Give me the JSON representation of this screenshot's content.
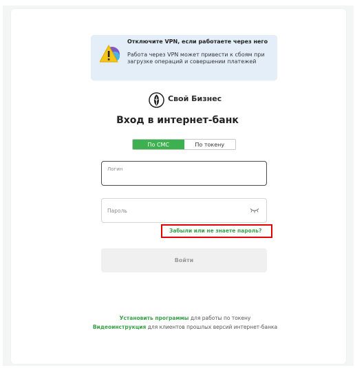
{
  "vpn_notice": {
    "title": "Отключите VPN, если работаете через него",
    "body": "Работа через VPN может привести к сбоям при загрузке операций и совершении платежей",
    "icon": "warning-icon"
  },
  "brand": {
    "name": "Свой Бизнес",
    "icon": "brand-logo"
  },
  "page_title": "Вход в интернет-банк",
  "tabs": [
    {
      "label": "По СМС",
      "active": true
    },
    {
      "label": "По токену",
      "active": false
    }
  ],
  "login_field": {
    "label": "Логин"
  },
  "password_field": {
    "label": "Пароль",
    "icon": "eye-closed-icon"
  },
  "forgot_link": "Забыли или не знаете пароль?",
  "login_button": "Войти",
  "footer": {
    "line1_link": "Установить программы",
    "line1_text": " для работы по токену",
    "line2_link": "Видеоинструкция",
    "line2_text": " для клиентов прошлых версий интернет-банка"
  },
  "colors": {
    "accent": "#3db14f",
    "highlight": "#e00000",
    "notice_bg": "#e4eef9"
  }
}
